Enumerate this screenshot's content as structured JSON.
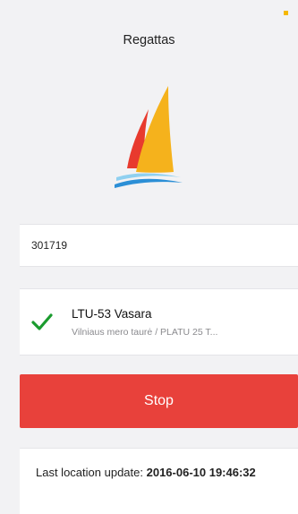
{
  "status_bar": {
    "indicator_color": "#f5b800"
  },
  "nav": {
    "title": "Regattas"
  },
  "logo": {
    "icon": "sailboat-logo-icon",
    "colors": {
      "red_sail": "#e83a2e",
      "yellow_sail": "#f5b21c",
      "wave_blue": "#2c8fd6",
      "wave_light": "#8fd0f0"
    }
  },
  "registration": {
    "code": "301719"
  },
  "boat": {
    "status_icon": "check-icon",
    "status_color": "#1a9b2e",
    "name": "LTU-53 Vasara",
    "event": "Vilniaus mero taurė / PLATU 25 T..."
  },
  "actions": {
    "stop_label": "Stop",
    "stop_color": "#e8413b"
  },
  "location": {
    "label": "Last location update:",
    "value": "2016-06-10 19:46:32"
  }
}
